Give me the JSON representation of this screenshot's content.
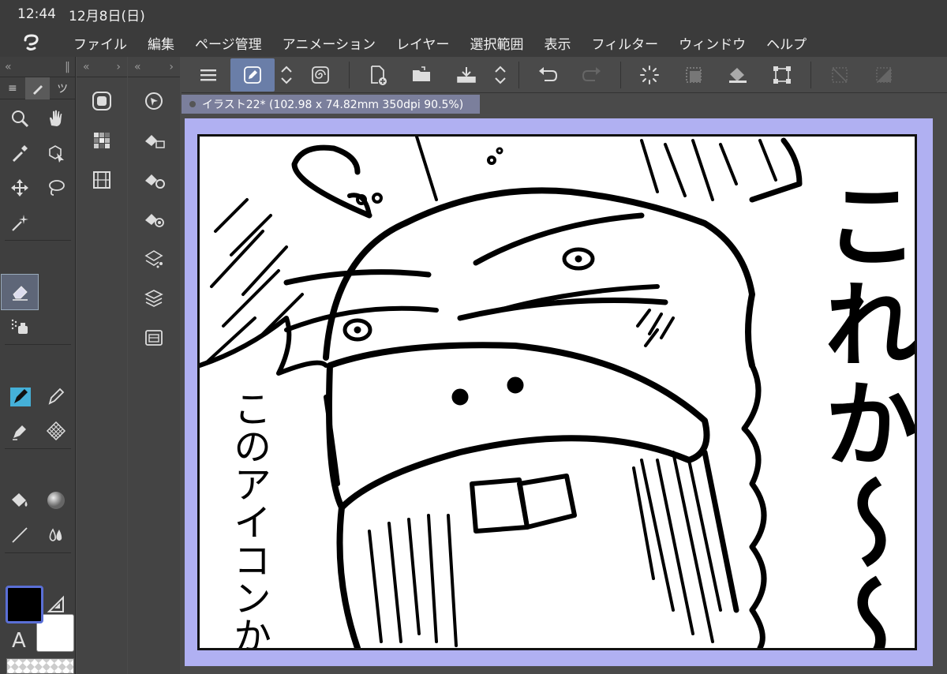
{
  "status": {
    "time": "12:44",
    "date": "12月8日(日)"
  },
  "menu": {
    "items": [
      "ファイル",
      "編集",
      "ページ管理",
      "アニメーション",
      "レイヤー",
      "選択範囲",
      "表示",
      "フィルター",
      "ウィンドウ",
      "ヘルプ"
    ]
  },
  "canvas": {
    "tab_title": "イラスト22* (102.98 x 74.82mm 350dpi 90.5%)",
    "text_vertical_right": "これか〜〜",
    "text_vertical_left": "このアイコンか〜"
  },
  "colors": {
    "accent": "#5a6fd6",
    "frame": "#b0b0f2",
    "tab": "#7b7f9c"
  },
  "tools": [
    "zoom-icon",
    "hand-icon",
    "eyedropper-icon",
    "object-icon",
    "move-icon",
    "lasso-icon",
    "magic-wand-icon",
    "eraser-icon",
    "airbrush-icon",
    "pen-icon",
    "pencil-icon",
    "marker-icon",
    "pattern-icon",
    "fill-icon",
    "gradient-icon",
    "line-icon",
    "blend-icon",
    "frame-icon",
    "ruler-icon",
    "text-icon",
    "burst-icon",
    "correct-line-icon"
  ]
}
